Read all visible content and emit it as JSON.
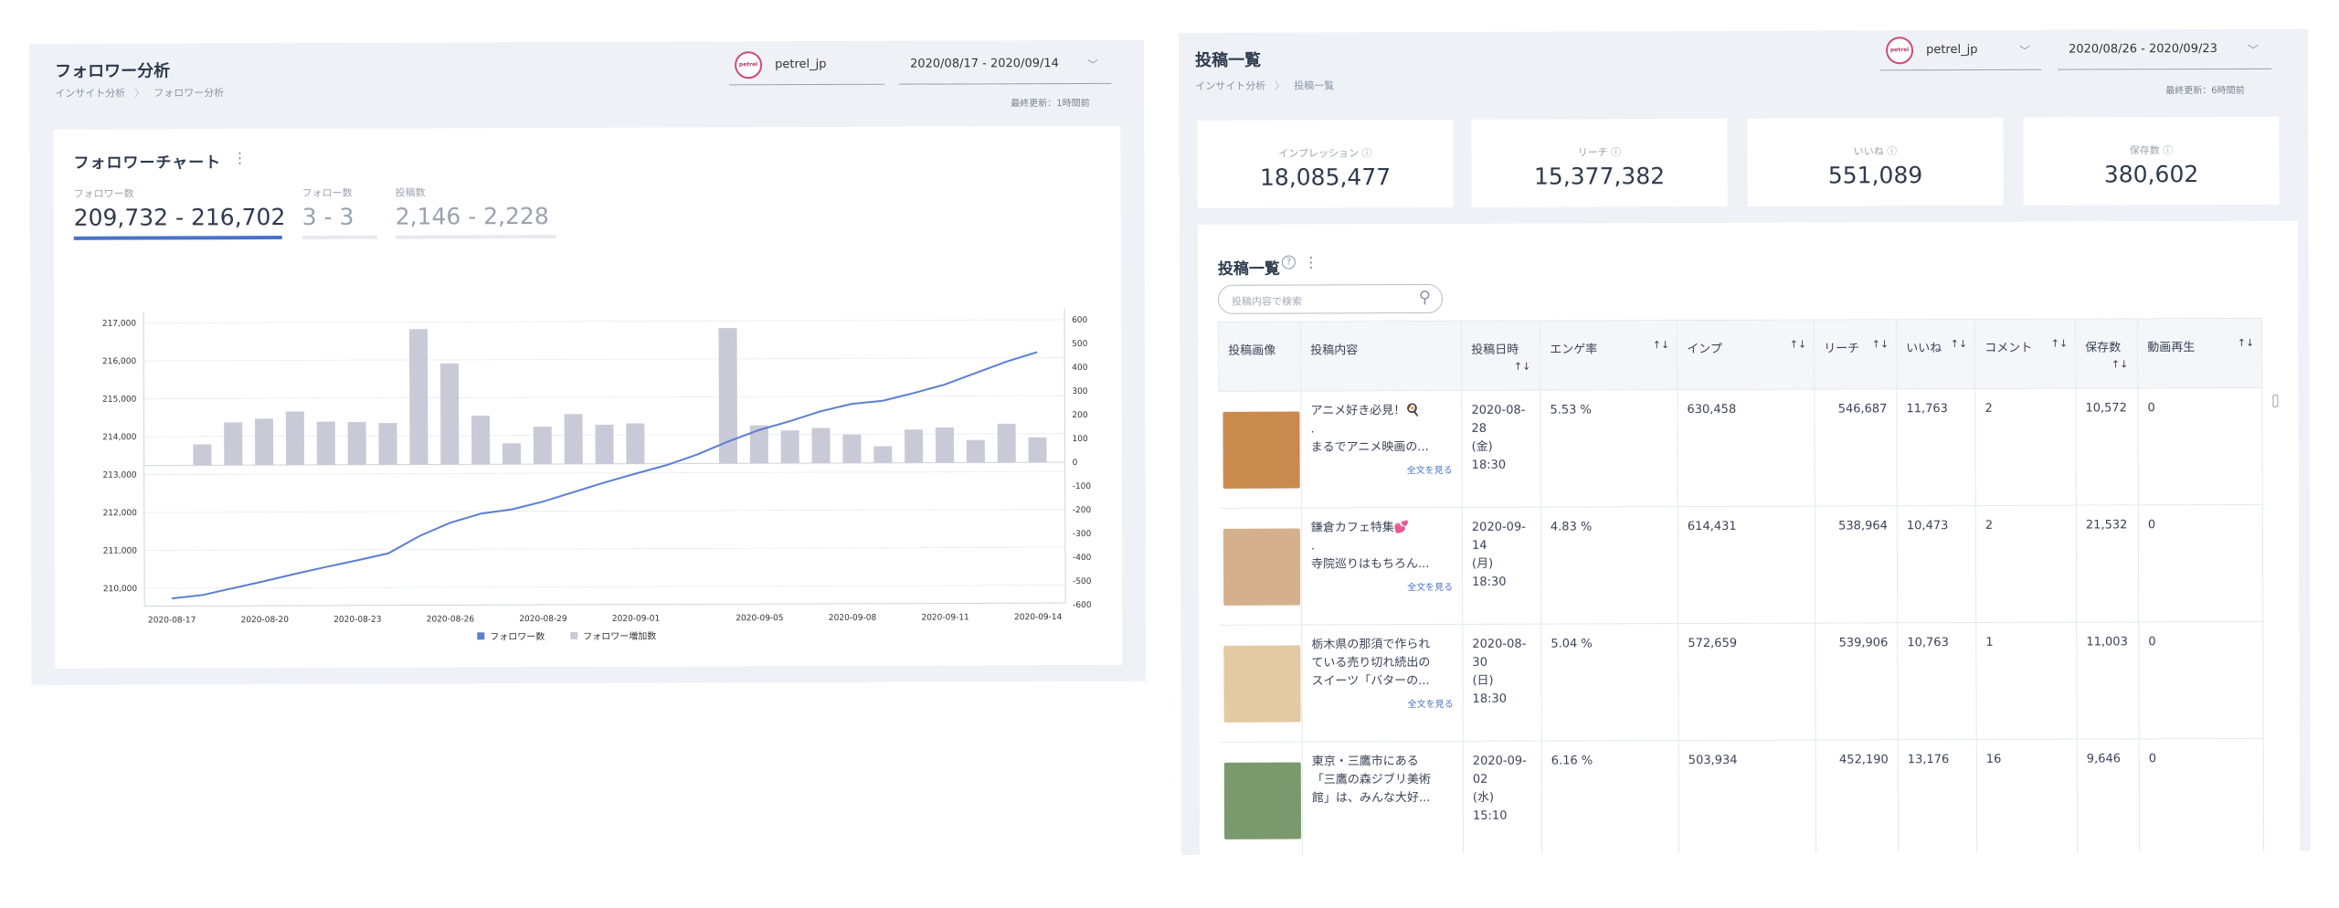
{
  "left": {
    "title": "フォロワー分析",
    "breadcrumb": [
      "インサイト分析",
      "フォロワー分析"
    ],
    "account": {
      "name": "petrel_jp",
      "logo_text": "petrel"
    },
    "date_range": "2020/08/17 - 2020/09/14",
    "updated": "最終更新：1時間前",
    "chart_card": {
      "title": "フォロワーチャート",
      "stats": [
        {
          "label": "フォロワー数",
          "value": "209,732 - 216,702",
          "active": true
        },
        {
          "label": "フォロー数",
          "value": "3 - 3",
          "active": false
        },
        {
          "label": "投稿数",
          "value": "2,146 - 2,228",
          "active": false
        }
      ]
    }
  },
  "chart_data": {
    "type": "line+bar",
    "title": "フォロワーチャート",
    "x": [
      "2020-08-17",
      "2020-08-18",
      "2020-08-19",
      "2020-08-20",
      "2020-08-21",
      "2020-08-22",
      "2020-08-23",
      "2020-08-24",
      "2020-08-25",
      "2020-08-26",
      "2020-08-27",
      "2020-08-28",
      "2020-08-29",
      "2020-08-30",
      "2020-08-31",
      "2020-09-01",
      "2020-09-02",
      "2020-09-03",
      "2020-09-04",
      "2020-09-05",
      "2020-09-06",
      "2020-09-07",
      "2020-09-08",
      "2020-09-09",
      "2020-09-10",
      "2020-09-11",
      "2020-09-12",
      "2020-09-13",
      "2020-09-14"
    ],
    "x_tick_labels": [
      "2020-08-17",
      "2020-08-20",
      "2020-08-23",
      "2020-08-26",
      "2020-08-29",
      "2020-09-01",
      "2020-09-05",
      "2020-09-08",
      "2020-09-11",
      "2020-09-14"
    ],
    "series": [
      {
        "name": "フォロワー数",
        "type": "line",
        "axis": "left",
        "color": "#5b7fd1",
        "values": [
          209732,
          209820,
          210000,
          210180,
          210370,
          210550,
          210720,
          210900,
          211350,
          211700,
          211940,
          212050,
          212250,
          212500,
          212750,
          212980,
          213200,
          213480,
          213820,
          214120,
          214350,
          214610,
          214800,
          214880,
          215080,
          215300,
          215600,
          215900,
          216150
        ]
      },
      {
        "name": "フォロワー増加数",
        "type": "bar",
        "axis": "right",
        "color": "#c8cad8",
        "values": [
          null,
          88,
          180,
          195,
          225,
          182,
          180,
          175,
          570,
          425,
          205,
          88,
          157,
          210,
          165,
          170,
          null,
          null,
          570,
          160,
          138,
          148,
          120,
          70,
          140,
          148,
          95,
          163,
          105
        ]
      }
    ],
    "y_left": {
      "ticks": [
        210000,
        211000,
        212000,
        213000,
        214000,
        215000,
        216000,
        217000
      ],
      "tick_labels": [
        "210,000",
        "211,000",
        "212,000",
        "213,000",
        "214,000",
        "215,000",
        "216,000",
        "217,000"
      ]
    },
    "y_right": {
      "ticks": [
        600,
        500,
        400,
        300,
        200,
        100,
        0,
        -100,
        -200,
        -300,
        -400,
        -500,
        -600
      ],
      "tick_labels": [
        "600",
        "500",
        "400",
        "300",
        "200",
        "100",
        "0",
        "-100",
        "-200",
        "-300",
        "-400",
        "-500",
        "-600"
      ]
    },
    "legend": [
      "フォロワー数",
      "フォロワー増加数"
    ],
    "legend_position": "bottom"
  },
  "right": {
    "title": "投稿一覧",
    "breadcrumb": [
      "インサイト分析",
      "投稿一覧"
    ],
    "account": {
      "name": "petrel_jp",
      "logo_text": "petrel"
    },
    "date_range": "2020/08/26 - 2020/09/23",
    "updated": "最終更新：6時間前",
    "metrics": [
      {
        "label": "インプレッション ⓘ",
        "value": "18,085,477"
      },
      {
        "label": "リーチ ⓘ",
        "value": "15,377,382"
      },
      {
        "label": "いいね ⓘ",
        "value": "551,089"
      },
      {
        "label": "保存数 ⓘ",
        "value": "380,602"
      }
    ],
    "posts_card": {
      "title": "投稿一覧",
      "search_placeholder": "投稿内容で検索",
      "columns": [
        "投稿画像",
        "投稿内容",
        "投稿日時",
        "エンゲ率",
        "インプ",
        "リーチ",
        "いいね",
        "コメント",
        "保存数",
        "動画再生"
      ],
      "sort_icon": "↑↓",
      "more_label": "全文を見る",
      "rows": [
        {
          "content": [
            "アニメ好き必見！🍳",
            ".",
            "まるでアニメ映画の..."
          ],
          "date": [
            "2020-08-",
            "28",
            "(金)",
            "18:30"
          ],
          "eng": "5.53 %",
          "imp": "630,458",
          "reach": "546,687",
          "likes": "11,763",
          "comments": "2",
          "saves": "10,572",
          "video": "0",
          "more": true,
          "thumb": "#c98a4e"
        },
        {
          "content": [
            "鎌倉カフェ特集💕",
            ".",
            "寺院巡りはもちろん..."
          ],
          "date": [
            "2020-09-",
            "14",
            "(月)",
            "18:30"
          ],
          "eng": "4.83 %",
          "imp": "614,431",
          "reach": "538,964",
          "likes": "10,473",
          "comments": "2",
          "saves": "21,532",
          "video": "0",
          "more": true,
          "thumb": "#d4b08c"
        },
        {
          "content": [
            "栃木県の那須で作られ",
            "ている売り切れ続出の",
            "スイーツ「バターの..."
          ],
          "date": [
            "2020-08-",
            "30",
            "(日)",
            "18:30"
          ],
          "eng": "5.04 %",
          "imp": "572,659",
          "reach": "539,906",
          "likes": "10,763",
          "comments": "1",
          "saves": "11,003",
          "video": "0",
          "more": true,
          "thumb": "#e3c9a4"
        },
        {
          "content": [
            "東京・三鷹市にある",
            "「三鷹の森ジブリ美術",
            "館」は、みんな大好..."
          ],
          "date": [
            "2020-09-",
            "02",
            "(水)",
            "15:10"
          ],
          "eng": "6.16 %",
          "imp": "503,934",
          "reach": "452,190",
          "likes": "13,176",
          "comments": "16",
          "saves": "9,646",
          "video": "0",
          "more": false,
          "thumb": "#7a9a6e"
        }
      ]
    }
  }
}
